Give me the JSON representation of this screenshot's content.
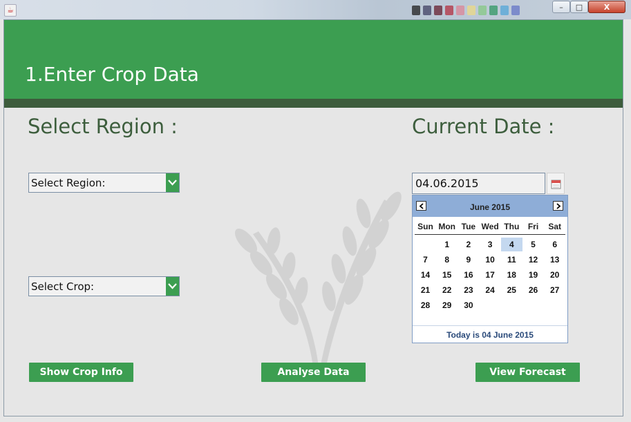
{
  "window": {
    "controls": {
      "minimize": "–",
      "maximize": "□",
      "close": "X"
    }
  },
  "header": {
    "title": "1.Enter Crop Data"
  },
  "sections": {
    "region_title": "Select Region :",
    "date_title": "Current Date :"
  },
  "region_combo": {
    "value": "Select Region:"
  },
  "crop_combo": {
    "value": "Select Crop:"
  },
  "date_field": {
    "value": "04.06.2015"
  },
  "calendar": {
    "month_label": "June 2015",
    "day_names": [
      "Sun",
      "Mon",
      "Tue",
      "Wed",
      "Thu",
      "Fri",
      "Sat"
    ],
    "weeks": [
      [
        "",
        "1",
        "2",
        "3",
        "4",
        "5",
        "6"
      ],
      [
        "7",
        "8",
        "9",
        "10",
        "11",
        "12",
        "13"
      ],
      [
        "14",
        "15",
        "16",
        "17",
        "18",
        "19",
        "20"
      ],
      [
        "21",
        "22",
        "23",
        "24",
        "25",
        "26",
        "27"
      ],
      [
        "28",
        "29",
        "30",
        "",
        "",
        "",
        ""
      ]
    ],
    "selected_day": "4",
    "today_text": "Today is  04 June 2015"
  },
  "buttons": {
    "show_crop_info": "Show Crop Info",
    "analyse_data": "Analyse Data",
    "view_forecast": "View Forecast"
  },
  "colors": {
    "primary_green": "#3c9e51",
    "dark_stripe": "#3d5c3c",
    "heading_text": "#3d5e3d",
    "calendar_header": "#8eadd7",
    "calendar_selected": "#c4d8ef"
  },
  "icons": [
    "java-app-icon",
    "calendar-icon",
    "chevron-down-icon",
    "arrow-left-icon",
    "arrow-right-icon",
    "wheat-watermark-icon"
  ]
}
